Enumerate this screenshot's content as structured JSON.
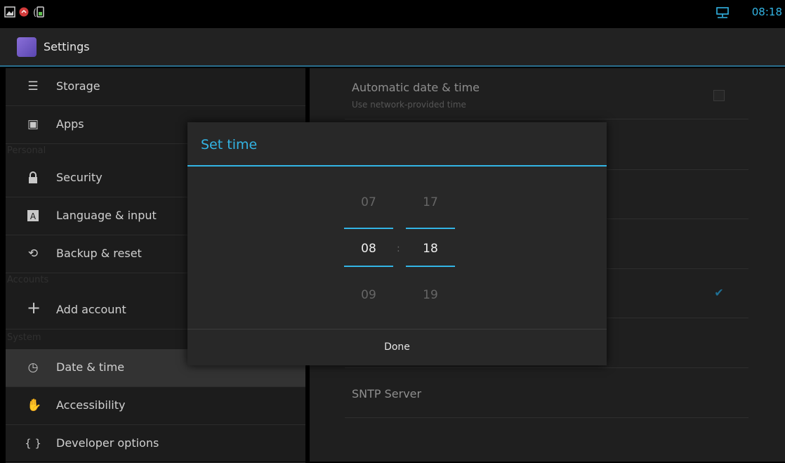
{
  "status": {
    "time": "08:18"
  },
  "app": {
    "title": "Settings"
  },
  "sidebar": {
    "items": [
      {
        "icon": "storage-icon",
        "glyph": "☰",
        "label": "Storage"
      },
      {
        "icon": "apps-icon",
        "glyph": "▣",
        "label": "Apps"
      },
      {
        "icon": "lock-icon",
        "glyph": "🔒",
        "label": "Security"
      },
      {
        "icon": "language-icon",
        "glyph": "A",
        "label": "Language & input"
      },
      {
        "icon": "backup-icon",
        "glyph": "⟲",
        "label": "Backup & reset"
      },
      {
        "icon": "plus-icon",
        "glyph": "+",
        "label": "Add account"
      },
      {
        "icon": "clock-icon",
        "glyph": "◷",
        "label": "Date & time"
      },
      {
        "icon": "hand-icon",
        "glyph": "✋",
        "label": "Accessibility"
      },
      {
        "icon": "braces-icon",
        "glyph": "{ }",
        "label": "Developer options"
      }
    ],
    "sections": [
      "Personal",
      "Accounts",
      "System"
    ]
  },
  "detail": {
    "auto_title": "Automatic date & time",
    "auto_sub": "Use network-provided time",
    "sntp_title": "SNTP Server"
  },
  "dialog": {
    "title": "Set time",
    "hour_prev": "07",
    "hour_cur": "08",
    "hour_next": "09",
    "min_prev": "17",
    "min_cur": "18",
    "min_next": "19",
    "separator": ":",
    "done_label": "Done"
  },
  "colors": {
    "accent": "#33b5e5"
  }
}
